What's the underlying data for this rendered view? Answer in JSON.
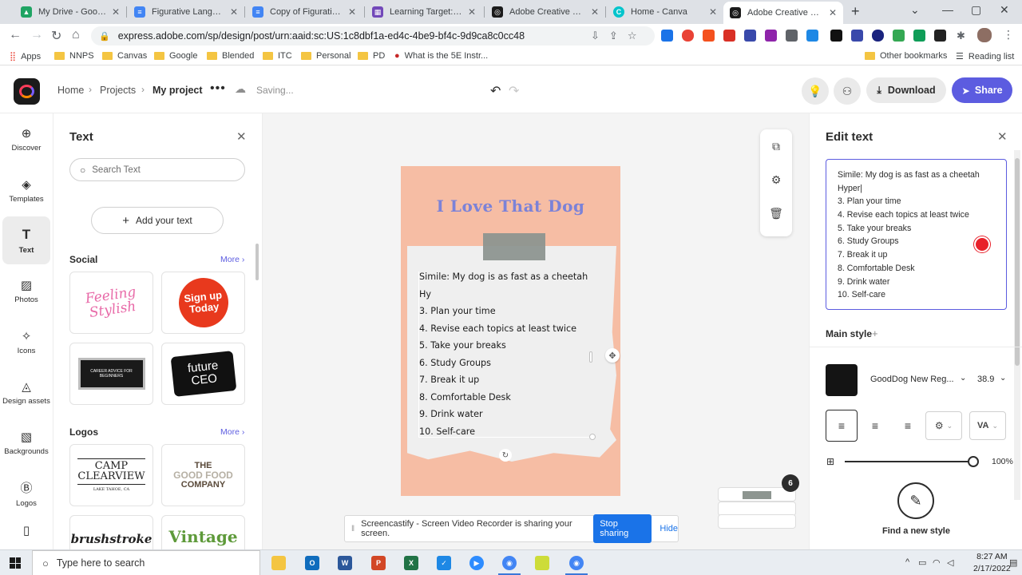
{
  "browser": {
    "tabs": [
      {
        "label": "My Drive - Google Drive",
        "color": "#1fa463",
        "glyph": "▲"
      },
      {
        "label": "Figurative Language Practice",
        "color": "#4285f4",
        "glyph": "≡"
      },
      {
        "label": "Copy of Figurative Language",
        "color": "#4285f4",
        "glyph": "≡"
      },
      {
        "label": "Learning Target: Apply",
        "color": "#e94235",
        "glyph": "G"
      },
      {
        "label": "Adobe Creative Cloud Express",
        "color": "#1b1b1b",
        "glyph": "◎"
      },
      {
        "label": "Home - Canva",
        "color": "#00c4cc",
        "glyph": "C"
      },
      {
        "label": "Adobe Creative Cloud Express",
        "color": "#1b1b1b",
        "glyph": "◎"
      }
    ],
    "url": "express.adobe.com/sp/design/post/urn:aaid:sc:US:1c8dbf1a-ed4c-4be9-bf4c-9d9ca8c0cc48",
    "bookmarks": [
      "Apps",
      "NNPS",
      "Canvas",
      "Google",
      "Blended",
      "ITC",
      "Personal",
      "PD",
      "What is the 5E Instr..."
    ],
    "other_bookmarks": "Other bookmarks",
    "reading_list": "Reading list"
  },
  "app": {
    "breadcrumb": {
      "home": "Home",
      "projects": "Projects",
      "current": "My project"
    },
    "status": "Saving...",
    "download_label": "Download",
    "share_label": "Share"
  },
  "rail": [
    {
      "label": "Discover",
      "icon": "🌐"
    },
    {
      "label": "Templates",
      "icon": "◈"
    },
    {
      "label": "Text",
      "icon": "T"
    },
    {
      "label": "Photos",
      "icon": "▨"
    },
    {
      "label": "Icons",
      "icon": "✧"
    },
    {
      "label": "Design assets",
      "icon": "◬"
    },
    {
      "label": "Backgrounds",
      "icon": "▧"
    },
    {
      "label": "Logos",
      "icon": "Ⓑ"
    }
  ],
  "text_panel": {
    "title": "Text",
    "search_placeholder": "Search Text",
    "add_text_label": "Add your text",
    "social_heading": "Social",
    "logos_heading": "Logos",
    "more_label": "More",
    "social_items": {
      "feeling_top": "Feeling",
      "feeling_bottom": "Stylish",
      "signup_top": "Sign up",
      "signup_bottom": "Today",
      "career": "CAREER ADVICE FOR BEGINNERS",
      "future_top": "future",
      "future_bottom": "CEO"
    },
    "logo_items": {
      "camp_top": "CAMP",
      "camp_bottom": "CLEARVIEW",
      "camp_sub": "LAKE TAHOE, CA",
      "goodfood_top": "THE",
      "goodfood_mid": "GOOD FOOD",
      "goodfood_bottom": "COMPANY",
      "brush": "brushstroke",
      "vintage": "Vintage"
    }
  },
  "canvas": {
    "title": "I Love That Dog",
    "list": [
      "Simile: My dog is as fast as a cheetah",
      "Hy",
      "3. Plan your time",
      "4. Revise each topics at least twice",
      "5. Take your breaks",
      "6. Study Groups",
      "7. Break it up",
      "8. Comfortable Desk",
      "9. Drink water",
      "10. Self-care"
    ],
    "page_count": "6"
  },
  "screencastify": {
    "message": "Screencastify - Screen Video Recorder is sharing your screen.",
    "stop_label": "Stop sharing",
    "hide_label": "Hide"
  },
  "edit_panel": {
    "title": "Edit text",
    "lines": [
      "Simile:  My dog is as fast as a cheetah",
      "Hyper",
      "3. Plan your time",
      "4. Revise each topics at least twice",
      "5. Take your breaks",
      "6. Study Groups",
      "7. Break it up",
      "8. Comfortable Desk",
      "9. Drink water",
      "10. Self-care"
    ],
    "main_style_label": "Main style",
    "font_name": "GoodDog New Reg...",
    "font_size": "38.9",
    "opacity": "100%",
    "find_style_label": "Find a new style",
    "color": "#141414"
  },
  "taskbar": {
    "search_placeholder": "Type here to search",
    "time": "8:27 AM",
    "date": "2/17/2022"
  }
}
